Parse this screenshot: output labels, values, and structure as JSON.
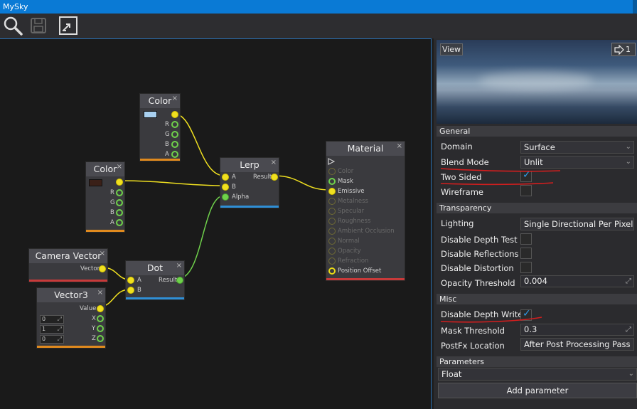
{
  "window": {
    "title": "MySky"
  },
  "toolbar": {
    "icons": [
      "search-icon",
      "save-icon",
      "fit-view-icon"
    ]
  },
  "graph": {
    "nodes": {
      "color1": {
        "title": "Color",
        "close": "×",
        "swatch": "#a8d0f0",
        "outputs": [
          "R",
          "G",
          "B",
          "A"
        ]
      },
      "color2": {
        "title": "Color",
        "close": "×",
        "swatch": "#3a2018",
        "outputs": [
          "R",
          "G",
          "B",
          "A"
        ]
      },
      "lerp": {
        "title": "Lerp",
        "close": "×",
        "inputs": [
          "A",
          "B",
          "Alpha"
        ],
        "output": "Result"
      },
      "material": {
        "title": "Material",
        "close": "×",
        "inputs": [
          "Color",
          "Mask",
          "Emissive",
          "Metalness",
          "Specular",
          "Roughness",
          "Ambient Occlusion",
          "Normal",
          "Opacity",
          "Refraction",
          "Position Offset"
        ]
      },
      "camera_vector": {
        "title": "Camera Vector",
        "close": "×",
        "output": "Vector"
      },
      "dot": {
        "title": "Dot",
        "close": "×",
        "inputs": [
          "A",
          "B"
        ],
        "output": "Result"
      },
      "vector3": {
        "title": "Vector3",
        "close": "×",
        "output": "Value",
        "values": [
          "0",
          "1",
          "0"
        ],
        "components": [
          "X",
          "Y",
          "Z"
        ]
      }
    }
  },
  "preview": {
    "view_label": "View",
    "camera_count": "1"
  },
  "properties": {
    "general": {
      "header": "General",
      "domain": {
        "label": "Domain",
        "value": "Surface"
      },
      "blend_mode": {
        "label": "Blend Mode",
        "value": "Unlit"
      },
      "two_sided": {
        "label": "Two Sided",
        "checked": true
      },
      "wireframe": {
        "label": "Wireframe",
        "checked": false
      }
    },
    "transparency": {
      "header": "Transparency",
      "lighting": {
        "label": "Lighting",
        "value": "Single Directional Per Pixel"
      },
      "disable_depth_test": {
        "label": "Disable Depth Test",
        "checked": false
      },
      "disable_reflections": {
        "label": "Disable Reflections",
        "checked": false
      },
      "disable_distortion": {
        "label": "Disable Distortion",
        "checked": false
      },
      "opacity_threshold": {
        "label": "Opacity Threshold",
        "value": "0.004"
      }
    },
    "misc": {
      "header": "Misc",
      "disable_depth_write": {
        "label": "Disable Depth Write",
        "checked": true
      },
      "mask_threshold": {
        "label": "Mask Threshold",
        "value": "0.3"
      },
      "postfx_location": {
        "label": "PostFx Location",
        "value": "After Post Processing Pass"
      }
    },
    "parameters": {
      "header": "Parameters",
      "type": "Float",
      "add_label": "Add parameter"
    }
  },
  "colors": {
    "accent": "#0a7ad5",
    "wire_yellow": "#f0e020",
    "wire_green": "#6fd14b",
    "annotation_red": "#d21e1e",
    "check_blue": "#2f9be8"
  }
}
